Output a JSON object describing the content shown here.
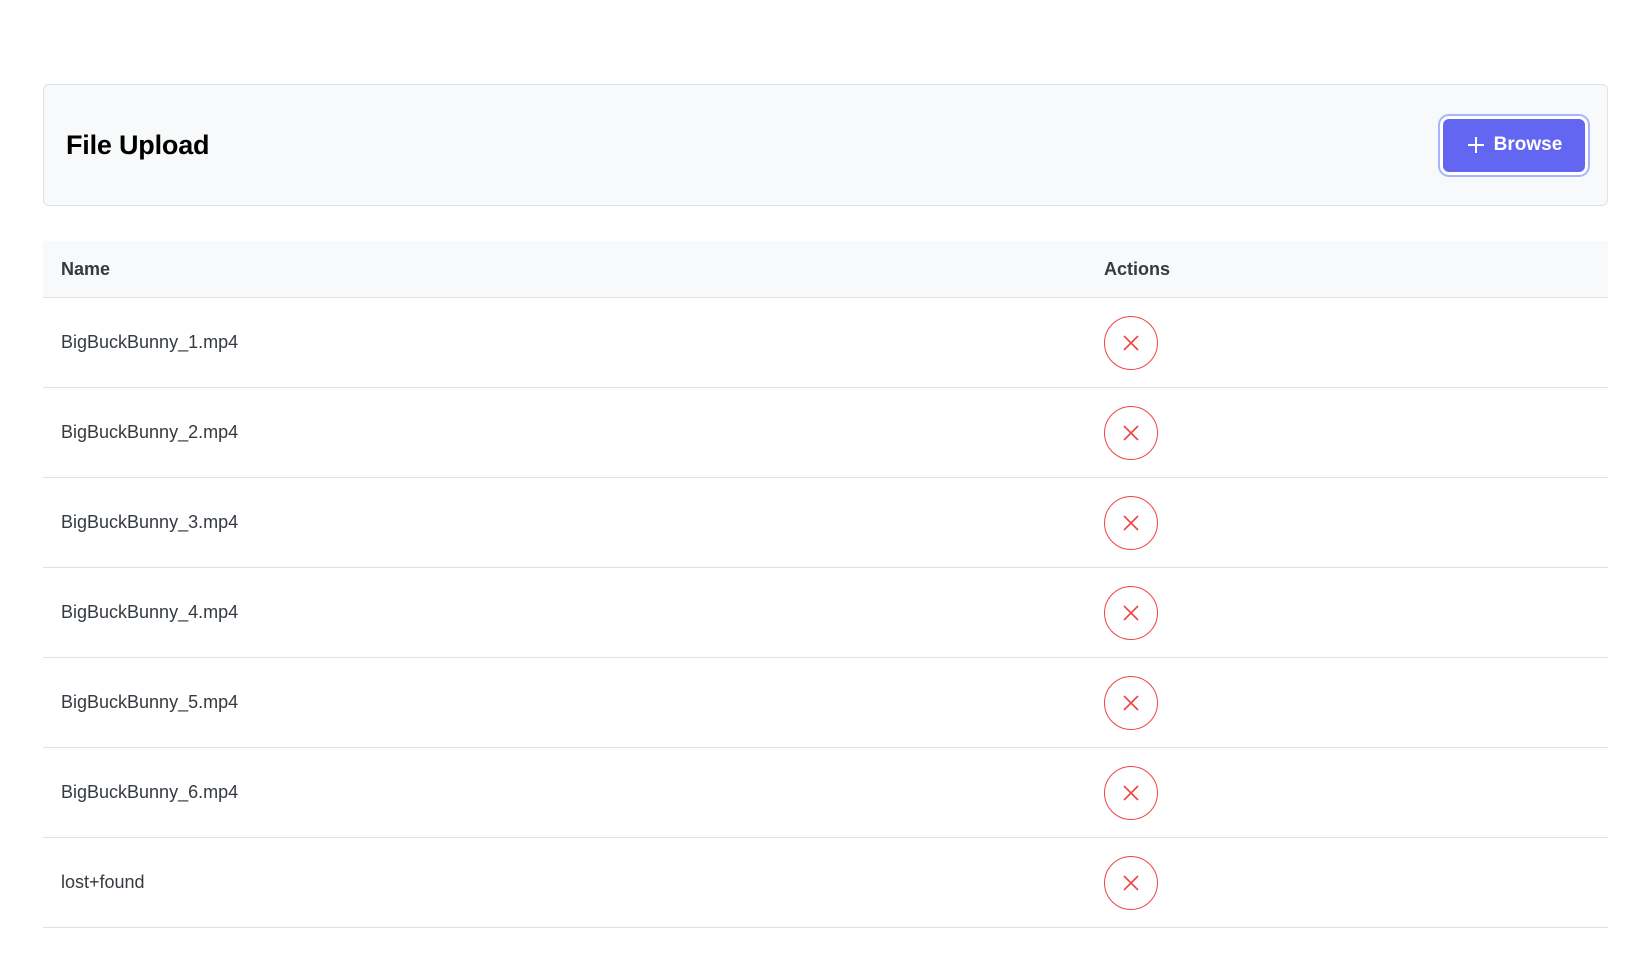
{
  "toolbar": {
    "title": "File Upload",
    "browse_label": "Browse",
    "browse_icon": "plus-icon"
  },
  "table": {
    "columns": [
      "Name",
      "Actions"
    ],
    "rows": [
      {
        "name": "BigBuckBunny_1.mp4",
        "action_icon": "times-icon"
      },
      {
        "name": "BigBuckBunny_2.mp4",
        "action_icon": "times-icon"
      },
      {
        "name": "BigBuckBunny_3.mp4",
        "action_icon": "times-icon"
      },
      {
        "name": "BigBuckBunny_4.mp4",
        "action_icon": "times-icon"
      },
      {
        "name": "BigBuckBunny_5.mp4",
        "action_icon": "times-icon"
      },
      {
        "name": "BigBuckBunny_6.mp4",
        "action_icon": "times-icon"
      },
      {
        "name": "lost+found",
        "action_icon": "times-icon"
      }
    ]
  },
  "colors": {
    "accent": "#6366f1",
    "danger": "#ef4444",
    "toolbar_bg": "#f8f9fa",
    "border": "#dee2e6"
  }
}
